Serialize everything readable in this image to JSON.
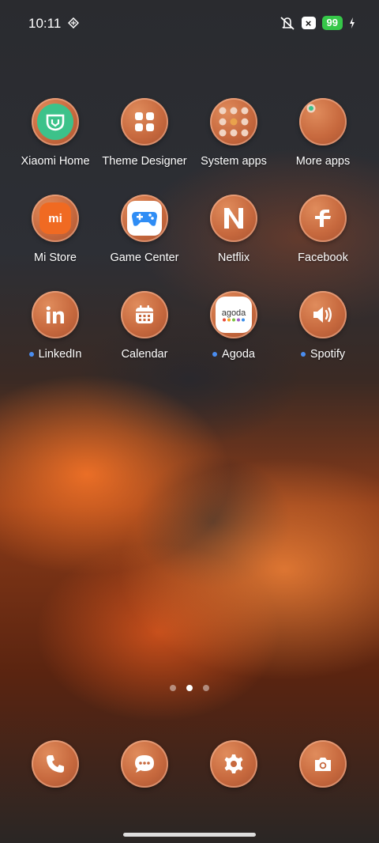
{
  "status_bar": {
    "time": "10:11",
    "battery": "99",
    "icons": [
      "shield-icon",
      "mute-icon",
      "x-badge-icon",
      "charging-icon"
    ]
  },
  "apps": [
    {
      "label": "Xiaomi Home",
      "icon": "xiaomi-home-icon",
      "notification": false
    },
    {
      "label": "Theme Designer",
      "icon": "grid-squares-icon",
      "notification": false
    },
    {
      "label": "System apps",
      "icon": "folder-icon",
      "notification": false
    },
    {
      "label": "More apps",
      "icon": "folder-icon",
      "notification": false
    },
    {
      "label": "Mi Store",
      "icon": "mi-store-icon",
      "notification": false
    },
    {
      "label": "Game Center",
      "icon": "gamepad-icon",
      "notification": false
    },
    {
      "label": "Netflix",
      "icon": "netflix-n-icon",
      "notification": false
    },
    {
      "label": "Facebook",
      "icon": "facebook-f-icon",
      "notification": false
    },
    {
      "label": "LinkedIn",
      "icon": "linkedin-icon",
      "notification": true
    },
    {
      "label": "Calendar",
      "icon": "calendar-icon",
      "notification": false
    },
    {
      "label": "Agoda",
      "icon": "agoda-icon",
      "notification": true
    },
    {
      "label": "Spotify",
      "icon": "speaker-icon",
      "notification": true
    }
  ],
  "agoda_text": "agoda",
  "mi_text": "mi",
  "page_indicator": {
    "count": 3,
    "active": 2
  },
  "dock": [
    "phone-icon",
    "message-icon",
    "settings-icon",
    "camera-icon"
  ],
  "colors": {
    "icon_copper": "#c7693e",
    "notification_dot": "#4a8df0",
    "battery_green": "#36c749"
  }
}
